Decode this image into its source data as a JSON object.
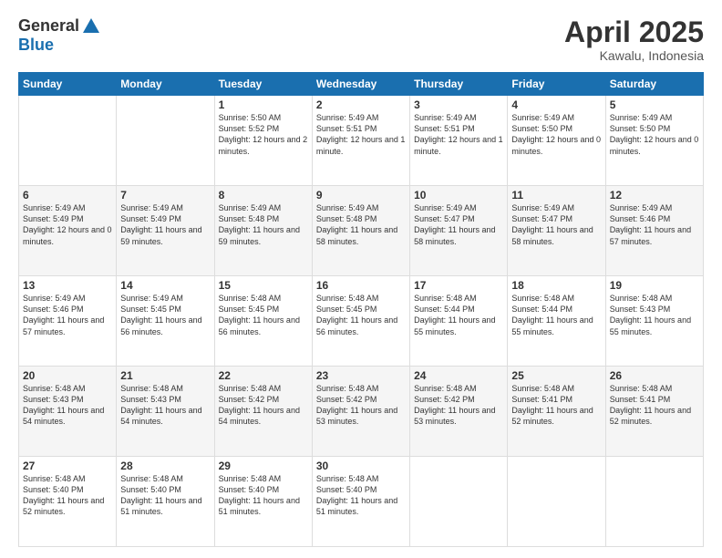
{
  "header": {
    "logo_general": "General",
    "logo_blue": "Blue",
    "month_title": "April 2025",
    "location": "Kawalu, Indonesia"
  },
  "weekdays": [
    "Sunday",
    "Monday",
    "Tuesday",
    "Wednesday",
    "Thursday",
    "Friday",
    "Saturday"
  ],
  "weeks": [
    [
      {
        "day": "",
        "text": ""
      },
      {
        "day": "",
        "text": ""
      },
      {
        "day": "1",
        "text": "Sunrise: 5:50 AM\nSunset: 5:52 PM\nDaylight: 12 hours\nand 2 minutes."
      },
      {
        "day": "2",
        "text": "Sunrise: 5:49 AM\nSunset: 5:51 PM\nDaylight: 12 hours\nand 1 minute."
      },
      {
        "day": "3",
        "text": "Sunrise: 5:49 AM\nSunset: 5:51 PM\nDaylight: 12 hours\nand 1 minute."
      },
      {
        "day": "4",
        "text": "Sunrise: 5:49 AM\nSunset: 5:50 PM\nDaylight: 12 hours\nand 0 minutes."
      },
      {
        "day": "5",
        "text": "Sunrise: 5:49 AM\nSunset: 5:50 PM\nDaylight: 12 hours\nand 0 minutes."
      }
    ],
    [
      {
        "day": "6",
        "text": "Sunrise: 5:49 AM\nSunset: 5:49 PM\nDaylight: 12 hours\nand 0 minutes."
      },
      {
        "day": "7",
        "text": "Sunrise: 5:49 AM\nSunset: 5:49 PM\nDaylight: 11 hours\nand 59 minutes."
      },
      {
        "day": "8",
        "text": "Sunrise: 5:49 AM\nSunset: 5:48 PM\nDaylight: 11 hours\nand 59 minutes."
      },
      {
        "day": "9",
        "text": "Sunrise: 5:49 AM\nSunset: 5:48 PM\nDaylight: 11 hours\nand 58 minutes."
      },
      {
        "day": "10",
        "text": "Sunrise: 5:49 AM\nSunset: 5:47 PM\nDaylight: 11 hours\nand 58 minutes."
      },
      {
        "day": "11",
        "text": "Sunrise: 5:49 AM\nSunset: 5:47 PM\nDaylight: 11 hours\nand 58 minutes."
      },
      {
        "day": "12",
        "text": "Sunrise: 5:49 AM\nSunset: 5:46 PM\nDaylight: 11 hours\nand 57 minutes."
      }
    ],
    [
      {
        "day": "13",
        "text": "Sunrise: 5:49 AM\nSunset: 5:46 PM\nDaylight: 11 hours\nand 57 minutes."
      },
      {
        "day": "14",
        "text": "Sunrise: 5:49 AM\nSunset: 5:45 PM\nDaylight: 11 hours\nand 56 minutes."
      },
      {
        "day": "15",
        "text": "Sunrise: 5:48 AM\nSunset: 5:45 PM\nDaylight: 11 hours\nand 56 minutes."
      },
      {
        "day": "16",
        "text": "Sunrise: 5:48 AM\nSunset: 5:45 PM\nDaylight: 11 hours\nand 56 minutes."
      },
      {
        "day": "17",
        "text": "Sunrise: 5:48 AM\nSunset: 5:44 PM\nDaylight: 11 hours\nand 55 minutes."
      },
      {
        "day": "18",
        "text": "Sunrise: 5:48 AM\nSunset: 5:44 PM\nDaylight: 11 hours\nand 55 minutes."
      },
      {
        "day": "19",
        "text": "Sunrise: 5:48 AM\nSunset: 5:43 PM\nDaylight: 11 hours\nand 55 minutes."
      }
    ],
    [
      {
        "day": "20",
        "text": "Sunrise: 5:48 AM\nSunset: 5:43 PM\nDaylight: 11 hours\nand 54 minutes."
      },
      {
        "day": "21",
        "text": "Sunrise: 5:48 AM\nSunset: 5:43 PM\nDaylight: 11 hours\nand 54 minutes."
      },
      {
        "day": "22",
        "text": "Sunrise: 5:48 AM\nSunset: 5:42 PM\nDaylight: 11 hours\nand 54 minutes."
      },
      {
        "day": "23",
        "text": "Sunrise: 5:48 AM\nSunset: 5:42 PM\nDaylight: 11 hours\nand 53 minutes."
      },
      {
        "day": "24",
        "text": "Sunrise: 5:48 AM\nSunset: 5:42 PM\nDaylight: 11 hours\nand 53 minutes."
      },
      {
        "day": "25",
        "text": "Sunrise: 5:48 AM\nSunset: 5:41 PM\nDaylight: 11 hours\nand 52 minutes."
      },
      {
        "day": "26",
        "text": "Sunrise: 5:48 AM\nSunset: 5:41 PM\nDaylight: 11 hours\nand 52 minutes."
      }
    ],
    [
      {
        "day": "27",
        "text": "Sunrise: 5:48 AM\nSunset: 5:40 PM\nDaylight: 11 hours\nand 52 minutes."
      },
      {
        "day": "28",
        "text": "Sunrise: 5:48 AM\nSunset: 5:40 PM\nDaylight: 11 hours\nand 51 minutes."
      },
      {
        "day": "29",
        "text": "Sunrise: 5:48 AM\nSunset: 5:40 PM\nDaylight: 11 hours\nand 51 minutes."
      },
      {
        "day": "30",
        "text": "Sunrise: 5:48 AM\nSunset: 5:40 PM\nDaylight: 11 hours\nand 51 minutes."
      },
      {
        "day": "",
        "text": ""
      },
      {
        "day": "",
        "text": ""
      },
      {
        "day": "",
        "text": ""
      }
    ]
  ]
}
